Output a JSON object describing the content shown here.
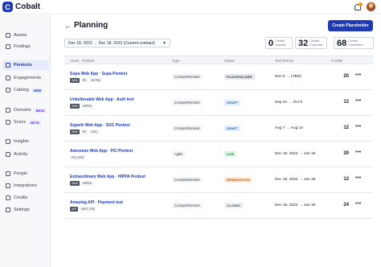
{
  "app": {
    "logo_mark": "C",
    "logo_text": "Cobalt"
  },
  "sidebar": {
    "items": [
      {
        "label": "Assets",
        "icon": "box-icon"
      },
      {
        "label": "Findings",
        "icon": "bug-icon"
      },
      {
        "label": "Pentests",
        "icon": "shield-icon",
        "active": true
      },
      {
        "label": "Engagements",
        "icon": "briefcase-icon"
      },
      {
        "label": "Catalog",
        "icon": "grid-icon",
        "badge": "NEW"
      },
      {
        "label": "Domains",
        "icon": "globe-icon",
        "badge": "BETA"
      },
      {
        "label": "Scans",
        "icon": "radar-icon",
        "badge": "BETA"
      },
      {
        "label": "Insights",
        "icon": "chart-icon"
      },
      {
        "label": "Activity",
        "icon": "pulse-icon"
      },
      {
        "label": "People",
        "icon": "people-icon"
      },
      {
        "label": "Integrations",
        "icon": "plug-icon"
      },
      {
        "label": "Credits",
        "icon": "coin-icon"
      },
      {
        "label": "Settings",
        "icon": "gear-icon"
      }
    ]
  },
  "header": {
    "title": "Planning",
    "create_button": "Create Placeholder",
    "date_range": "Dec 18, 2022 → Dec 18, 2023 (Current contract)"
  },
  "credits_summary": [
    {
      "value": "0",
      "label": "Credits Unused"
    },
    {
      "value": "32",
      "label": "Credits Projected"
    },
    {
      "value": "68",
      "label": "Credits Committed"
    }
  ],
  "table": {
    "columns": [
      "Asset · Pentest",
      "Type",
      "Status",
      "Test Period",
      "Credits"
    ],
    "rows": [
      {
        "title": "Supa Web App · Supa Pentest",
        "tags": [
          {
            "t": "Web",
            "dark": true
          },
          {
            "t": "PII"
          },
          {
            "t": "HIPPA"
          }
        ],
        "type": "Comprehensive",
        "status": "PLACEHOLDER",
        "period": "Nov 6 → (TBD)",
        "credits": "20"
      },
      {
        "title": "Unbelievable Web App · Auth test",
        "tags": [
          {
            "t": "Web",
            "dark": true
          },
          {
            "t": "HIPPA"
          }
        ],
        "type": "Comprehensive",
        "status": "DRAFT",
        "period": "Sep 22 → Oct 5",
        "credits": "12"
      },
      {
        "title": "Superb Web App · SOC Pentest",
        "tags": [
          {
            "t": "Web",
            "dark": true
          },
          {
            "t": "PII"
          },
          {
            "t": "SOC"
          }
        ],
        "type": "Comprehensive",
        "status": "DRAFT",
        "period": "Aug 7 → Aug 14",
        "credits": "12"
      },
      {
        "title": "Awesome Web App · PCI Pentest",
        "tags": [
          {
            "t": "PCI DSS"
          }
        ],
        "type": "Agile",
        "status": "LIVE",
        "period": "Dec 18, 2022 → Jan 18",
        "credits": "20"
      },
      {
        "title": "Extraordinary Web App · HIPPA Pentest",
        "tags": [
          {
            "t": "Web",
            "dark": true
          },
          {
            "t": "HIPPA"
          }
        ],
        "type": "Comprehensive",
        "status": "REMEDIATION",
        "period": "Dec 18, 2022 → Jan 18",
        "credits": "12"
      },
      {
        "title": "Amazing API · Payment test",
        "tags": [
          {
            "t": "API",
            "dark": true
          },
          {
            "t": "NIST CSF"
          }
        ],
        "type": "Comprehensive",
        "status": "CLOSED",
        "period": "Dec 18, 2022 → Jan 18",
        "credits": "24"
      }
    ]
  },
  "colors": {
    "accent": "#1f3bb3",
    "status": {
      "PLACEHOLDER": [
        "#e5e7eb",
        "#374151"
      ],
      "DRAFT": [
        "#e3f0fb",
        "#1e6aa8"
      ],
      "LIVE": [
        "#dcf5e4",
        "#15803d"
      ],
      "REMEDIATION": [
        "#fdeadf",
        "#b45309"
      ],
      "CLOSED": [
        "#eef0f3",
        "#4b5563"
      ]
    }
  }
}
